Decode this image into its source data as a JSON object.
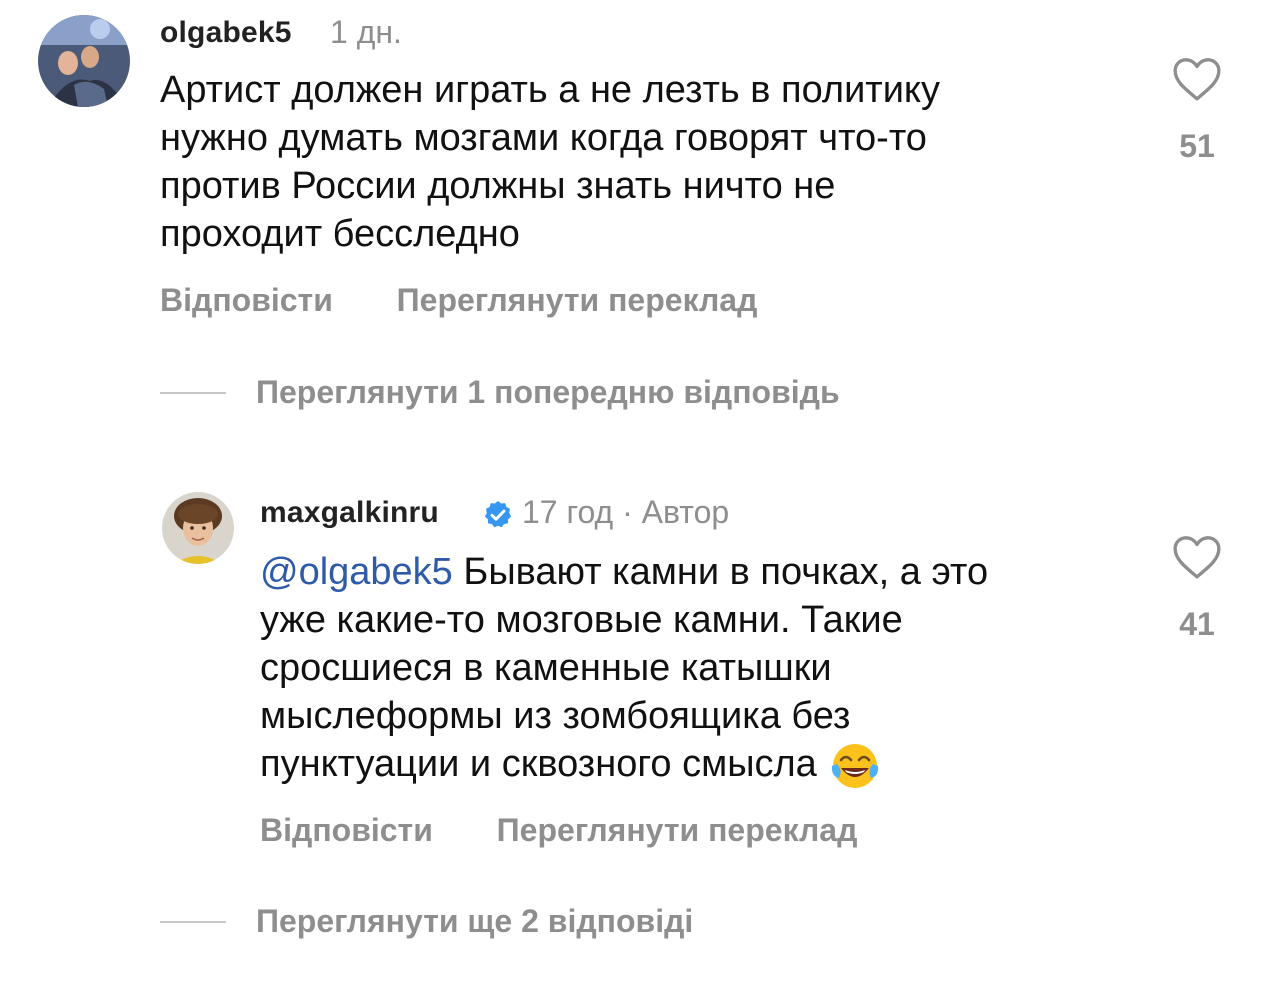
{
  "comments": [
    {
      "username": "olgabek5",
      "time": "1 дн.",
      "text_lines": [
        "Артист должен играть а не лезть в политику",
        "нужно думать мозгами когда говорят что-то",
        "против России  должны знать ничто не",
        "проходит бесследно"
      ],
      "reply_label": "Відповісти",
      "translate_label": "Переглянути переклад",
      "like_count": "51",
      "icons": {
        "like": "heart-outline-icon"
      }
    },
    {
      "username": "maxgalkinru",
      "verified": true,
      "meta": "17 год · Автор",
      "mention": "@olgabek5",
      "text_first_line_rest": " Бывают камни в почках, а это",
      "text_lines": [
        "уже какие-то мозговые камни. Такие",
        "сросшиеся в каменные катышки",
        "мыслеформы из зомбоящика без"
      ],
      "text_last_line": "пунктуации и сквозного смысла",
      "emoji": "tears-of-joy-emoji",
      "reply_label": "Відповісти",
      "translate_label": "Переглянути переклад",
      "like_count": "41",
      "icons": {
        "like": "heart-outline-icon",
        "verified": "verified-badge-icon"
      }
    }
  ],
  "threads": {
    "previous_reply": "Переглянути 1 попередню відповідь",
    "more_replies": "Переглянути ще 2 відповіді"
  },
  "colors": {
    "secondary_text": "#8e8e8e",
    "mention": "#2e5aa9",
    "verified": "#3797f0"
  }
}
